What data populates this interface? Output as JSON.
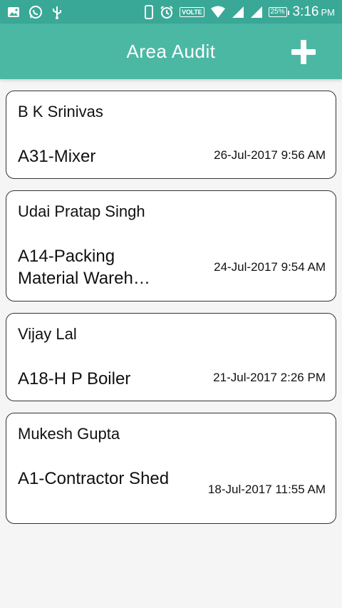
{
  "status_bar": {
    "time": "3:16",
    "ampm": "PM",
    "volte": "VOLTE",
    "battery": "25%",
    "icons": [
      "image-icon",
      "whatsapp-icon",
      "usb-icon",
      "phone-vibrate-icon",
      "alarm-icon",
      "wifi-icon",
      "signal-icon",
      "signal-icon"
    ]
  },
  "header": {
    "title": "Area Audit",
    "add_icon": "plus-icon"
  },
  "colors": {
    "status_bar": "#3aa897",
    "app_bar": "#4bb8a4",
    "card_border": "#333333",
    "background": "#f5f5f5"
  },
  "audits": [
    {
      "name": "B K Srinivas",
      "area": "A31-Mixer",
      "date": "26-Jul-2017 9:56 AM"
    },
    {
      "name": "Udai Pratap Singh",
      "area": "A14-Packing Material Wareh…",
      "date": "24-Jul-2017 9:54 AM"
    },
    {
      "name": "Vijay Lal",
      "area": "A18-H P Boiler",
      "date": "21-Jul-2017 2:26 PM"
    },
    {
      "name": "Mukesh Gupta",
      "area": "A1-Contractor Shed",
      "date": "18-Jul-2017 11:55 AM"
    }
  ]
}
